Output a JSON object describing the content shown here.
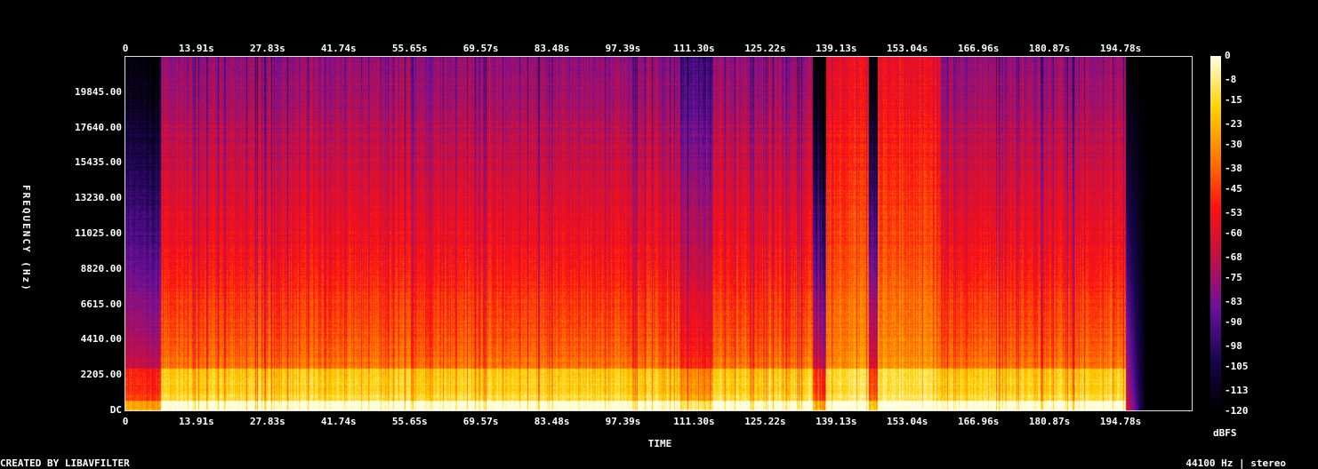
{
  "chart_data": {
    "type": "heatmap",
    "title": "",
    "xlabel": "TIME",
    "ylabel": "FREQUENCY (Hz)",
    "x_ticks": [
      "0",
      "13.91s",
      "27.83s",
      "41.74s",
      "55.65s",
      "69.57s",
      "83.48s",
      "97.39s",
      "111.30s",
      "125.22s",
      "139.13s",
      "153.04s",
      "166.96s",
      "180.87s",
      "194.78s"
    ],
    "x_tick_values_s": [
      0,
      13.91,
      27.83,
      41.74,
      55.65,
      69.57,
      83.48,
      97.39,
      111.3,
      125.22,
      139.13,
      153.04,
      166.96,
      180.87,
      194.78
    ],
    "xlim_s": [
      0,
      208.7
    ],
    "y_ticks": [
      "DC",
      "2205.00",
      "4410.00",
      "6615.00",
      "8820.00",
      "11025.00",
      "13230.00",
      "15435.00",
      "17640.00",
      "19845.00"
    ],
    "y_tick_values_hz": [
      0,
      2205,
      4410,
      6615,
      8820,
      11025,
      13230,
      15435,
      17640,
      19845
    ],
    "ylim_hz": [
      0,
      22050
    ],
    "colorbar": {
      "label": "dBFS",
      "ticks": [
        "0",
        "-8",
        "-15",
        "-23",
        "-30",
        "-38",
        "-45",
        "-53",
        "-60",
        "-68",
        "-75",
        "-83",
        "-90",
        "-98",
        "-105",
        "-113",
        "-120"
      ],
      "range_db": [
        -120,
        0
      ],
      "colormap": [
        "#000000",
        "#1a0550",
        "#6a10a0",
        "#c0104a",
        "#ff1010",
        "#ff7a00",
        "#ffd400",
        "#ffffe0"
      ]
    },
    "audio_end_s": 195.7,
    "segments_s": [
      {
        "start": 0,
        "end": 6.8,
        "level": "quiet"
      },
      {
        "start": 6.8,
        "end": 108.5,
        "level": "loud"
      },
      {
        "start": 108.5,
        "end": 115.0,
        "level": "medium"
      },
      {
        "start": 115.0,
        "end": 134.5,
        "level": "loud"
      },
      {
        "start": 134.5,
        "end": 137.0,
        "level": "dark"
      },
      {
        "start": 137.0,
        "end": 145.5,
        "level": "loud-high"
      },
      {
        "start": 145.5,
        "end": 147.2,
        "level": "dark"
      },
      {
        "start": 147.2,
        "end": 159.5,
        "level": "loud-high"
      },
      {
        "start": 159.5,
        "end": 168.0,
        "level": "loud"
      },
      {
        "start": 168.0,
        "end": 195.7,
        "level": "loud"
      }
    ]
  },
  "footer": {
    "left": "CREATED BY LIBAVFILTER",
    "right": "44100 Hz | stereo"
  }
}
